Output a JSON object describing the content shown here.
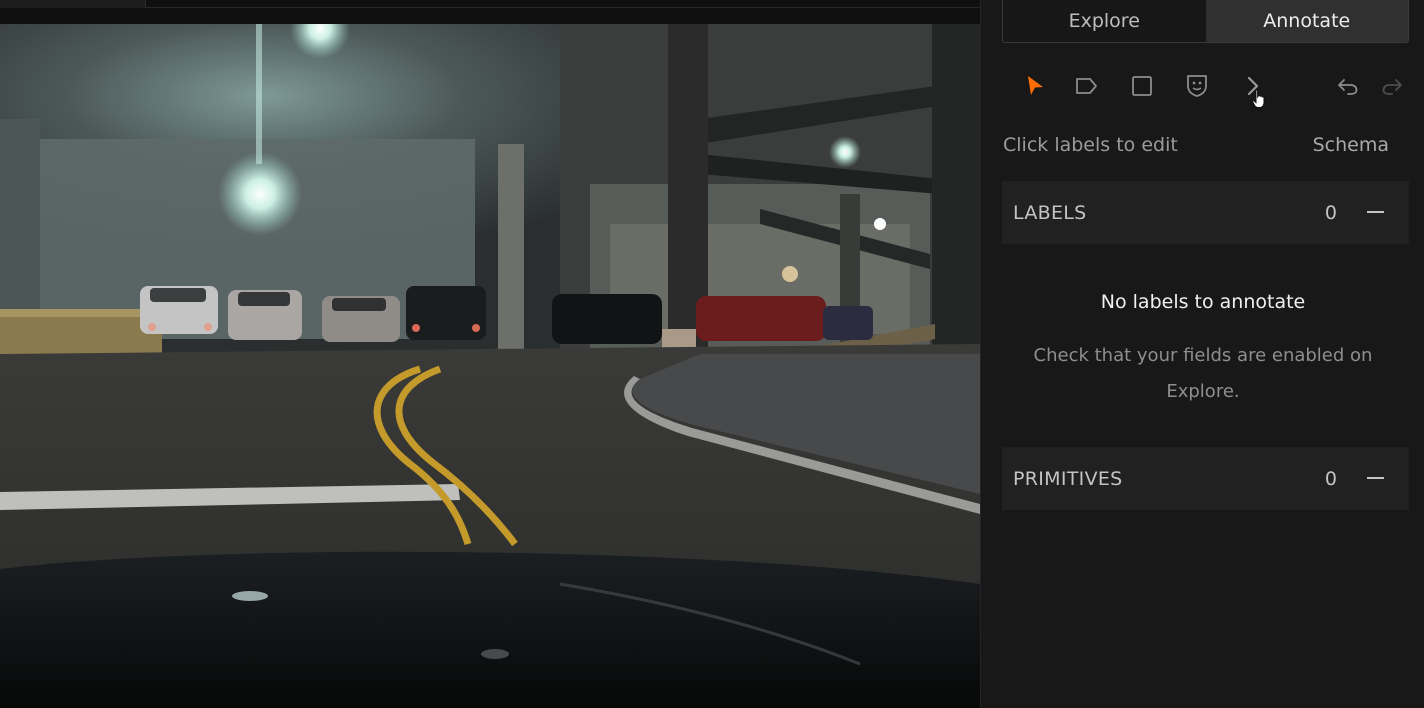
{
  "mode_tabs": [
    {
      "label": "Explore",
      "active": false
    },
    {
      "label": "Annotate",
      "active": true
    }
  ],
  "toolbar": {
    "tools": [
      "select-arrow-icon",
      "label-tag-icon",
      "bounding-box-icon",
      "mask-shield-icon",
      "chevron-right-icon"
    ],
    "history": [
      "undo-icon",
      "redo-icon"
    ],
    "active_tool": "select-arrow-icon",
    "accent_color": "#ff6d04"
  },
  "panel": {
    "edit_hint": "Click labels to edit",
    "schema_link": "Schema"
  },
  "sections": {
    "labels": {
      "title": "LABELS",
      "count": "0"
    },
    "primitives": {
      "title": "PRIMITIVES",
      "count": "0"
    }
  },
  "empty_state": {
    "title": "No labels to annotate",
    "body": "Check that your fields are enabled on Explore."
  },
  "viewer": {
    "scene": "night parking garage viewed from car dashboard"
  }
}
